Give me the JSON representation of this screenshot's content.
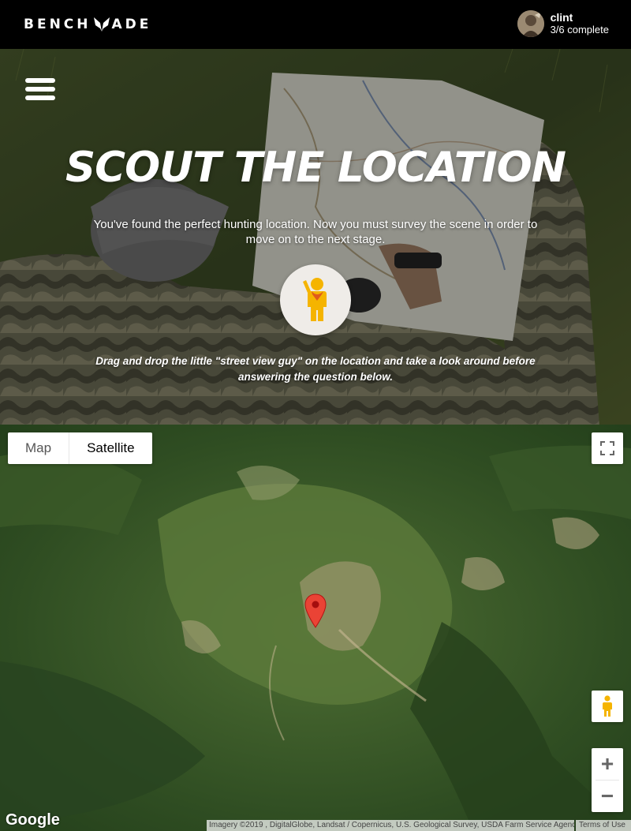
{
  "brand": {
    "logo_text_left": "BENCH",
    "logo_text_right": "ADE"
  },
  "user": {
    "name": "clint",
    "progress": "3/6 complete"
  },
  "hero": {
    "title": "SCOUT THE LOCATION",
    "description": "You've found the perfect hunting location. Now you must survey the scene in order to move on to the next stage.",
    "instruction": "Drag and drop the little \"street view guy\" on the location and take a look around before answering the question below."
  },
  "map": {
    "type_options": {
      "map_label": "Map",
      "satellite_label": "Satellite",
      "selected": "Satellite"
    },
    "zoom_in_label": "+",
    "zoom_out_label": "−",
    "google_logo": "Google",
    "attribution": "Imagery ©2019 , DigitalGlobe, Landsat / Copernicus, U.S. Geological Survey, USDA Farm Service Agency",
    "terms": "Terms of Use"
  },
  "colors": {
    "topbar": "#000000",
    "pegman": "#f5b400",
    "marker": "#ea4335"
  }
}
